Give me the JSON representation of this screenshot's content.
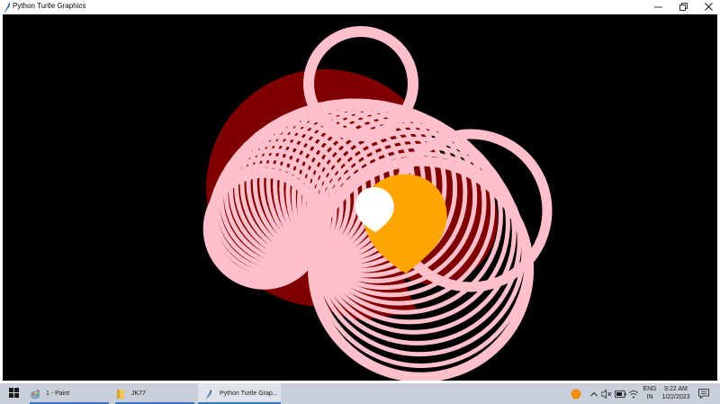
{
  "window": {
    "title": "Python Turtle Graphics",
    "minimize_label": "minimize",
    "maximize_label": "maximize",
    "close_label": "close"
  },
  "canvas": {
    "background": "#000000",
    "colors": {
      "rings": "#ffc0cb",
      "fill_dark": "#800000",
      "fill_orange": "#ffa500",
      "fill_white": "#ffffff"
    }
  },
  "taskbar": {
    "items": [
      {
        "label": "1 - Paint",
        "icon": "paint-icon"
      },
      {
        "label": "JK77",
        "icon": "folder-icon"
      },
      {
        "label": "Python Turtle Grap...",
        "icon": "python-feather-icon",
        "active": true
      }
    ],
    "language": {
      "line1": "ENG",
      "line2": "IN"
    },
    "clock": {
      "time": "9:22 AM",
      "date": "1/22/2023"
    },
    "accent": "#3a78c2"
  }
}
